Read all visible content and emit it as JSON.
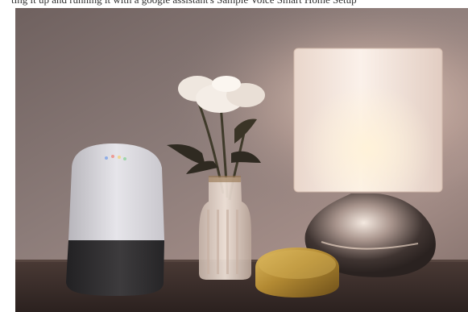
{
  "caption": {
    "text": "ting it up and running it with a google assistant's Sample Voice Smart Home Setup"
  },
  "photo": {
    "subject": "photo",
    "objects": [
      {
        "name": "smart-speaker",
        "icon": "smart-speaker-icon"
      },
      {
        "name": "flower-vase",
        "icon": "flower-vase-icon"
      },
      {
        "name": "table-lamp",
        "icon": "lamp-icon"
      },
      {
        "name": "gold-puck-device",
        "icon": "puck-icon"
      }
    ],
    "colors": {
      "wall_top": "#7f6e6d",
      "wall_bottom": "#9c8784",
      "table": "#3d302c",
      "lampshade": "#f7e9de",
      "speaker_top": "#d9d9dd",
      "speaker_base": "#343334",
      "puck": "#b58b33"
    }
  }
}
